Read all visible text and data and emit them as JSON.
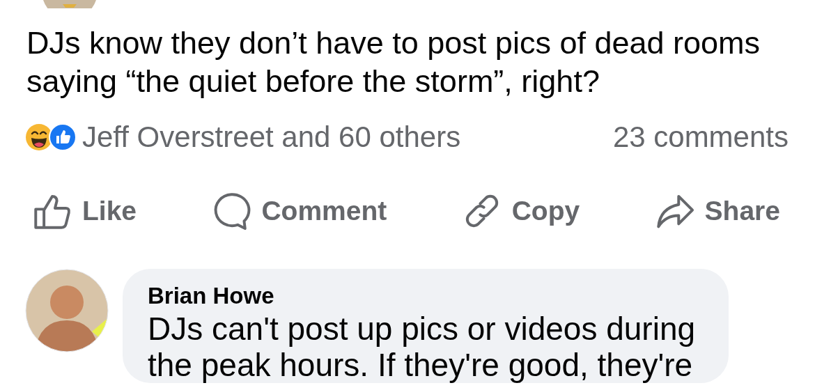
{
  "post": {
    "text": "DJs know they don’t have to post pics of dead rooms saying “the quiet before the storm”, right?",
    "reactions": {
      "summary": "Jeff Overstreet and 60 others",
      "comments": "23 comments"
    }
  },
  "actions": [
    {
      "kind": "like",
      "label": "Like"
    },
    {
      "kind": "comment",
      "label": "Comment"
    },
    {
      "kind": "copy",
      "label": "Copy"
    },
    {
      "kind": "share",
      "label": "Share"
    }
  ],
  "comments": [
    {
      "author": "Brian Howe",
      "text": "DJs can't post up pics or videos during the peak hours. If they're good, they're"
    }
  ]
}
